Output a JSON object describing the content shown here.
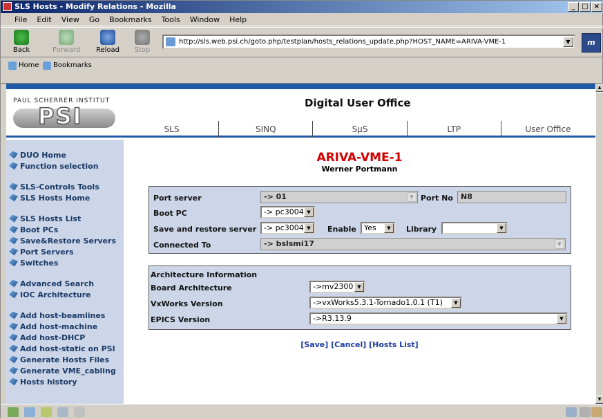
{
  "window": {
    "title": "SLS Hosts - Modify Relations - Mozilla",
    "controls": [
      "_",
      "□",
      "×"
    ]
  },
  "menu": [
    "File",
    "Edit",
    "View",
    "Go",
    "Bookmarks",
    "Tools",
    "Window",
    "Help"
  ],
  "toolbar": {
    "back": "Back",
    "forward": "Forward",
    "reload": "Reload",
    "stop": "Stop",
    "url": "http://sls.web.psi.ch/goto.php/testplan/hosts_relations_update.php?HOST_NAME=ARIVA-VME-1"
  },
  "personal": {
    "home": "Home",
    "bookmarks": "Bookmarks"
  },
  "header": {
    "institute": "PAUL SCHERRER INSTITUT",
    "logo": "PSI",
    "title": "Digital User Office",
    "nav": [
      "SLS",
      "SINQ",
      "SμS",
      "LTP",
      "User Office"
    ]
  },
  "sidebar": {
    "groups": [
      [
        "DUO Home",
        "Function selection"
      ],
      [
        "SLS-Controls Tools",
        "SLS Hosts Home"
      ],
      [
        "SLS Hosts List",
        "Boot PCs",
        "Save&Restore Servers",
        "Port Servers",
        "Switches"
      ],
      [
        "Advanced Search",
        "IOC Architecture"
      ],
      [
        "Add host-beamlines",
        "Add host-machine",
        "Add host-DHCP",
        "Add host-static on PSI",
        "Generate Hosts Files",
        "Generate VME_cabling",
        "Hosts history"
      ]
    ]
  },
  "record": {
    "name": "ARIVA-VME-1",
    "owner": "Werner Portmann"
  },
  "form1": {
    "port_server_label": "Port server",
    "port_server_value": "-> 01",
    "port_no_label": "Port No",
    "port_no_value": "N8",
    "boot_pc_label": "Boot PC",
    "boot_pc_value": "-> pc3004",
    "sr_label": "Save and restore server",
    "sr_value": "-> pc3004",
    "enable_label": "Enable",
    "enable_value": "Yes",
    "library_label": "Library",
    "library_value": "",
    "connected_label": "Connected To",
    "connected_value": "-> bslsmi17"
  },
  "form2": {
    "heading": "Architecture Information",
    "board_label": "Board Architecture",
    "board_value": "->mv2300",
    "vxworks_label": "VxWorks Version",
    "vxworks_value": "->vxWorks5.3.1-Tornado1.0.1 (T1)",
    "epics_label": "EPICS Version",
    "epics_value": "->R3.13.9"
  },
  "actions": {
    "save": "[Save]",
    "cancel": "[Cancel]",
    "list": "[Hosts List]"
  }
}
